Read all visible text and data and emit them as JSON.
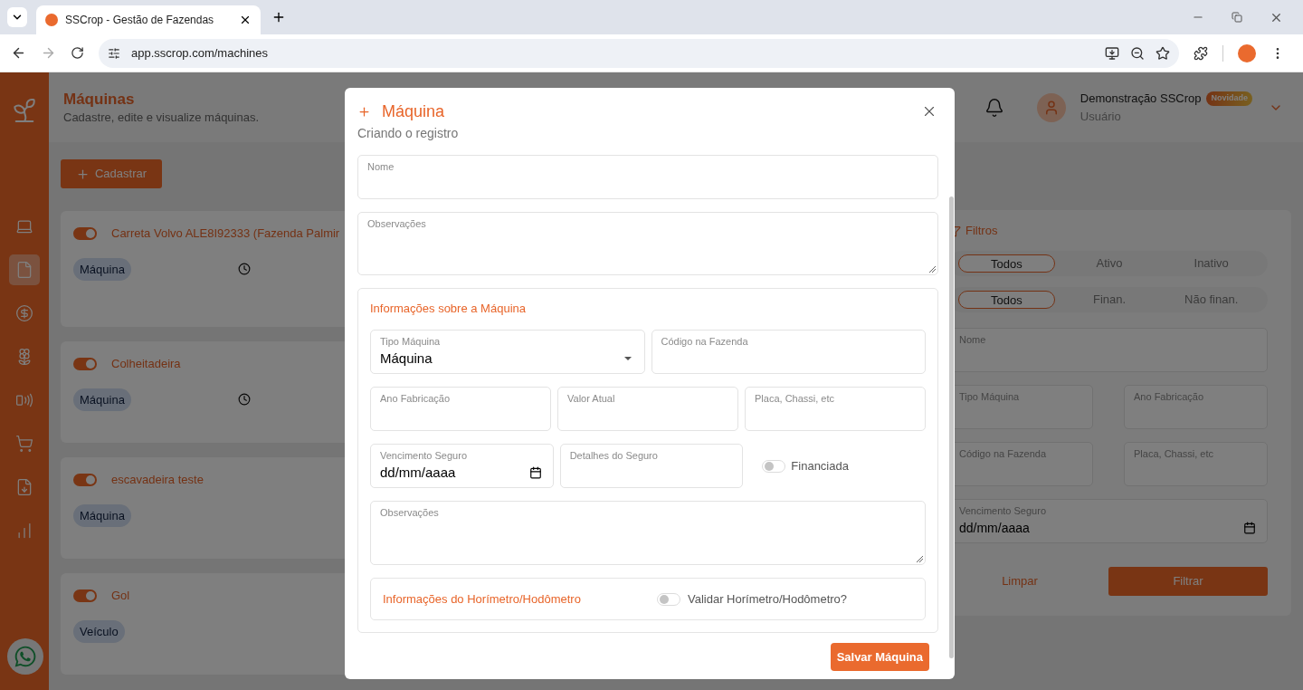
{
  "browser": {
    "tab_title": "SSCrop - Gestão de Fazendas",
    "url": "app.sscrop.com/machines"
  },
  "sidebar": {
    "items": [
      {
        "kind": "laptop",
        "selected": false
      },
      {
        "kind": "document",
        "selected": true
      },
      {
        "kind": "dollar",
        "selected": false
      },
      {
        "kind": "plant",
        "selected": false
      },
      {
        "kind": "phone",
        "selected": false
      },
      {
        "kind": "cart",
        "selected": false
      },
      {
        "kind": "download",
        "selected": false
      },
      {
        "kind": "chart",
        "selected": false
      }
    ]
  },
  "header": {
    "title": "Máquinas",
    "subtitle": "Cadastre, edite e visualize máquinas.",
    "user_name": "Demonstração SSCrop",
    "badge": "Novidade",
    "role": "Usuário"
  },
  "add_button": "Cadastrar",
  "machines": [
    {
      "name": "Carreta Volvo ALE8I92333 (Fazenda Palmir",
      "active": true,
      "tag": "Máquina",
      "history": true
    },
    {
      "name": "Colheitadeira",
      "active": true,
      "tag": "Máquina",
      "history": true
    },
    {
      "name": "escavadeira teste",
      "active": true,
      "tag": "Máquina",
      "history": false
    },
    {
      "name": "Gol",
      "active": true,
      "tag": "Veículo",
      "history": false
    }
  ],
  "filters": {
    "title": "Filtros",
    "status": [
      {
        "label": "Todos",
        "selected": true
      },
      {
        "label": "Ativo",
        "selected": false
      },
      {
        "label": "Inativo",
        "selected": false
      }
    ],
    "financing": [
      {
        "label": "Todos",
        "selected": true
      },
      {
        "label": "Finan.",
        "selected": false
      },
      {
        "label": "Não finan.",
        "selected": false
      }
    ],
    "rows": [
      [
        {
          "label": "Nome",
          "kind": "text"
        }
      ],
      [
        {
          "label": "Tipo Máquina",
          "kind": "text"
        },
        {
          "label": "Ano Fabricação",
          "kind": "text"
        }
      ],
      [
        {
          "label": "Código na Fazenda",
          "kind": "text"
        },
        {
          "label": "Placa, Chassi, etc",
          "kind": "text"
        }
      ],
      [
        {
          "label": "Vencimento Seguro",
          "kind": "date",
          "value": "dd/mm/aaaa"
        }
      ]
    ],
    "clear_button": "Limpar",
    "apply_button": "Filtrar"
  },
  "modal": {
    "title": "Máquina",
    "subtitle": "Criando o registro",
    "fields": [
      {
        "label": "Nome",
        "kind": "text"
      },
      {
        "label": "Observações",
        "kind": "textarea"
      }
    ],
    "section": {
      "title": "Informações sobre a Máquina",
      "rows": [
        [
          {
            "label": "Tipo Máquina",
            "kind": "select",
            "value": "Máquina"
          },
          {
            "label": "Código na Fazenda",
            "kind": "text"
          }
        ],
        [
          {
            "label": "Ano Fabricação",
            "kind": "text"
          },
          {
            "label": "Valor Atual",
            "kind": "text"
          },
          {
            "label": "Placa, Chassi, etc",
            "kind": "text"
          }
        ],
        [
          {
            "label": "Vencimento Seguro",
            "kind": "date",
            "value": "dd/mm/aaaa"
          },
          {
            "label": "Detalhes do Seguro",
            "kind": "text"
          },
          {
            "label": "Financiada",
            "kind": "toggle",
            "on": false
          }
        ],
        [
          {
            "label": "Observações",
            "kind": "textarea"
          }
        ]
      ],
      "odometer": {
        "title": "Informações do Horímetro/Hodômetro",
        "toggle_label": "Validar Horímetro/Hodômetro?",
        "on": false
      }
    },
    "save_button": "Salvar Máquina"
  }
}
